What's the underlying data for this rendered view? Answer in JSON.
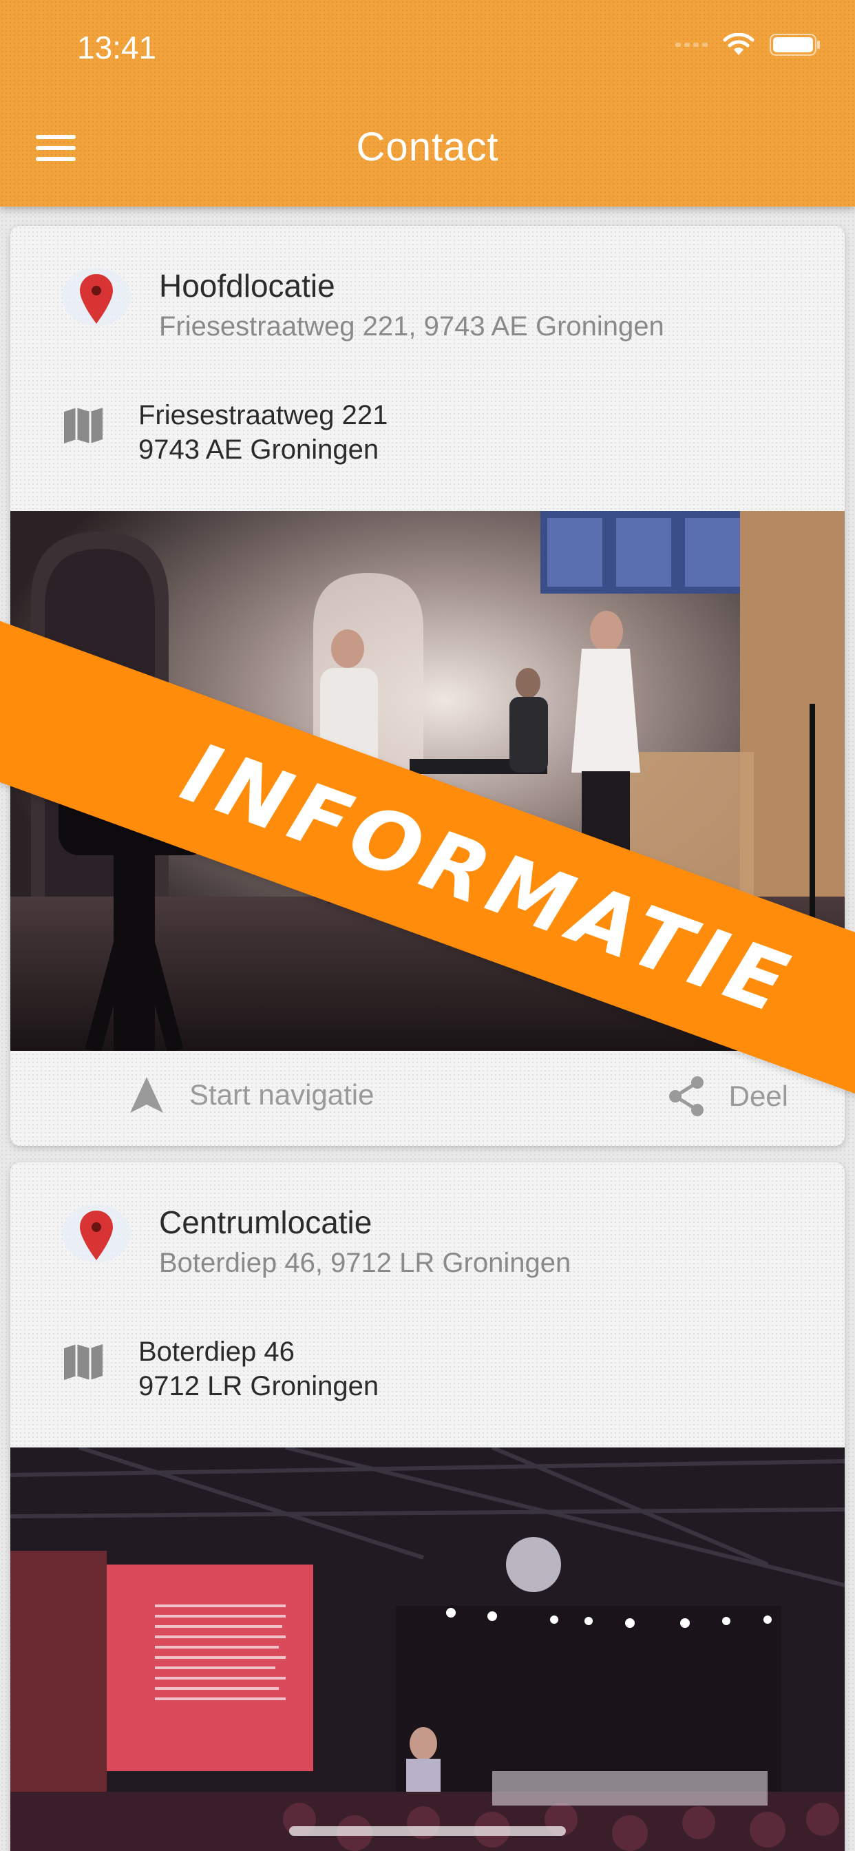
{
  "status_bar": {
    "time": "13:41"
  },
  "header": {
    "title": "Contact"
  },
  "locations": [
    {
      "title": "Hoofdlocatie",
      "subtitle": "Friesestraatweg 221, 9743 AE Groningen",
      "address_line1": "Friesestraatweg 221",
      "address_line2": "9743 AE Groningen",
      "nav_label": "Start navigatie",
      "share_label": "Deel"
    },
    {
      "title": "Centrumlocatie",
      "subtitle": "Boterdiep 46, 9712 LR Groningen",
      "address_line1": "Boterdiep 46",
      "address_line2": "9712 LR Groningen"
    }
  ],
  "banner": {
    "text": "INFORMATIE"
  },
  "colors": {
    "header": "#f2a33c",
    "banner": "#ff8c0a",
    "pin": "#d93434"
  },
  "icons": [
    "menu-icon",
    "wifi-icon",
    "battery-icon",
    "location-pin-icon",
    "map-icon",
    "navigation-arrow-icon",
    "share-icon"
  ]
}
